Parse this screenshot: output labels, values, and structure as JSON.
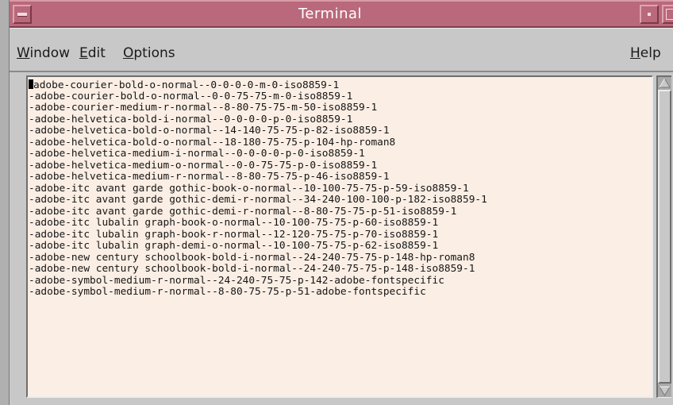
{
  "window": {
    "title": "Terminal"
  },
  "menubar": {
    "items": [
      {
        "mnemonic": "W",
        "rest": "indow"
      },
      {
        "mnemonic": "E",
        "rest": "dit"
      },
      {
        "mnemonic": "O",
        "rest": "ptions"
      }
    ],
    "help": {
      "mnemonic": "H",
      "rest": "elp"
    }
  },
  "terminal": {
    "lines": [
      "adobe-courier-bold-o-normal--0-0-0-0-m-0-iso8859-1",
      "-adobe-courier-bold-o-normal--0-0-75-75-m-0-iso8859-1",
      "-adobe-courier-medium-r-normal--8-80-75-75-m-50-iso8859-1",
      "-adobe-helvetica-bold-i-normal--0-0-0-0-p-0-iso8859-1",
      "-adobe-helvetica-bold-o-normal--14-140-75-75-p-82-iso8859-1",
      "-adobe-helvetica-bold-o-normal--18-180-75-75-p-104-hp-roman8",
      "-adobe-helvetica-medium-i-normal--0-0-0-0-p-0-iso8859-1",
      "-adobe-helvetica-medium-o-normal--0-0-75-75-p-0-iso8859-1",
      "-adobe-helvetica-medium-r-normal--8-80-75-75-p-46-iso8859-1",
      "-adobe-itc avant garde gothic-book-o-normal--10-100-75-75-p-59-iso8859-1",
      "-adobe-itc avant garde gothic-demi-r-normal--34-240-100-100-p-182-iso8859-1",
      "-adobe-itc avant garde gothic-demi-r-normal--8-80-75-75-p-51-iso8859-1",
      "-adobe-itc lubalin graph-book-o-normal--10-100-75-75-p-60-iso8859-1",
      "-adobe-itc lubalin graph-book-r-normal--12-120-75-75-p-70-iso8859-1",
      "-adobe-itc lubalin graph-demi-o-normal--10-100-75-75-p-62-iso8859-1",
      "-adobe-new century schoolbook-bold-i-normal--24-240-75-75-p-148-hp-roman8",
      "-adobe-new century schoolbook-bold-i-normal--24-240-75-75-p-148-iso8859-1",
      "-adobe-symbol-medium-r-normal--24-240-75-75-p-142-adobe-fontspecific",
      "-adobe-symbol-medium-r-normal--8-80-75-75-p-51-adobe-fontspecific"
    ]
  },
  "colors": {
    "titlebar": "#b9697b",
    "terminal_background": "#fbeee4",
    "window_background": "#c8c8c8"
  },
  "icons": {
    "window_menu": "window-menu-icon",
    "minimize": "minimize-icon",
    "maximize": "maximize-icon",
    "scroll_up": "scroll-up-arrow-icon",
    "scroll_down": "scroll-down-arrow-icon"
  }
}
